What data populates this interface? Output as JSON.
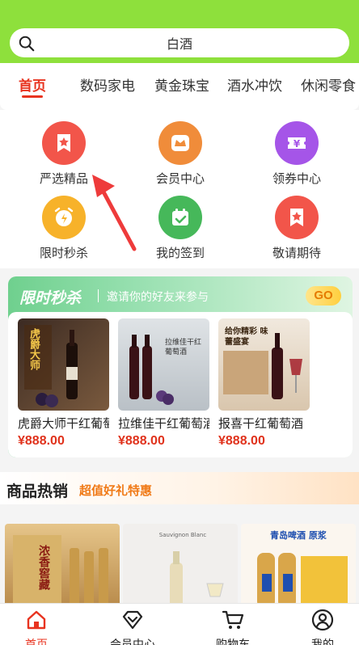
{
  "search": {
    "text": "白酒"
  },
  "tabs": [
    {
      "label": "首页",
      "active": true
    },
    {
      "label": "数码家电"
    },
    {
      "label": "黄金珠宝"
    },
    {
      "label": "酒水冲饮"
    },
    {
      "label": "休闲零食"
    }
  ],
  "grid": [
    {
      "label": "严选精品",
      "icon": "star-ribbon-icon",
      "color": "#f2554a"
    },
    {
      "label": "会员中心",
      "icon": "crown-icon",
      "color": "#f08c3a"
    },
    {
      "label": "领券中心",
      "icon": "yuan-coupon-icon",
      "color": "#a555e8"
    },
    {
      "label": "限时秒杀",
      "icon": "alarm-clock-icon",
      "color": "#f7b22a"
    },
    {
      "label": "我的签到",
      "icon": "calendar-check-icon",
      "color": "#46b85a"
    },
    {
      "label": "敬请期待",
      "icon": "star-ribbon-icon",
      "color": "#f2554a"
    }
  ],
  "flash": {
    "title": "限时秒杀",
    "subtitle": "邀请你的好友来参与",
    "go": "GO",
    "products": [
      {
        "name": "虎爵大师干红葡萄酒",
        "price": "¥888.00",
        "img_text": "虎爵大师"
      },
      {
        "name": "拉维佳干红葡萄酒",
        "price": "¥888.00",
        "img_text": "拉维佳干红葡萄酒"
      },
      {
        "name": "报喜干红葡萄酒",
        "price": "¥888.00",
        "img_text": "给你精彩 味蕾盛宴"
      }
    ]
  },
  "hot": {
    "title": "商品热销",
    "subtitle": "超值好礼特惠"
  },
  "goods": [
    {
      "img_text": "浓香窖藏"
    },
    {
      "img_text": "Sauvignon Blanc"
    },
    {
      "img_text": "青岛啤酒 原浆"
    }
  ],
  "bottom_nav": [
    {
      "label": "首页",
      "icon": "home-icon",
      "active": true
    },
    {
      "label": "会员中心",
      "icon": "diamond-icon"
    },
    {
      "label": "购物车",
      "icon": "cart-icon"
    },
    {
      "label": "我的",
      "icon": "user-icon"
    }
  ]
}
